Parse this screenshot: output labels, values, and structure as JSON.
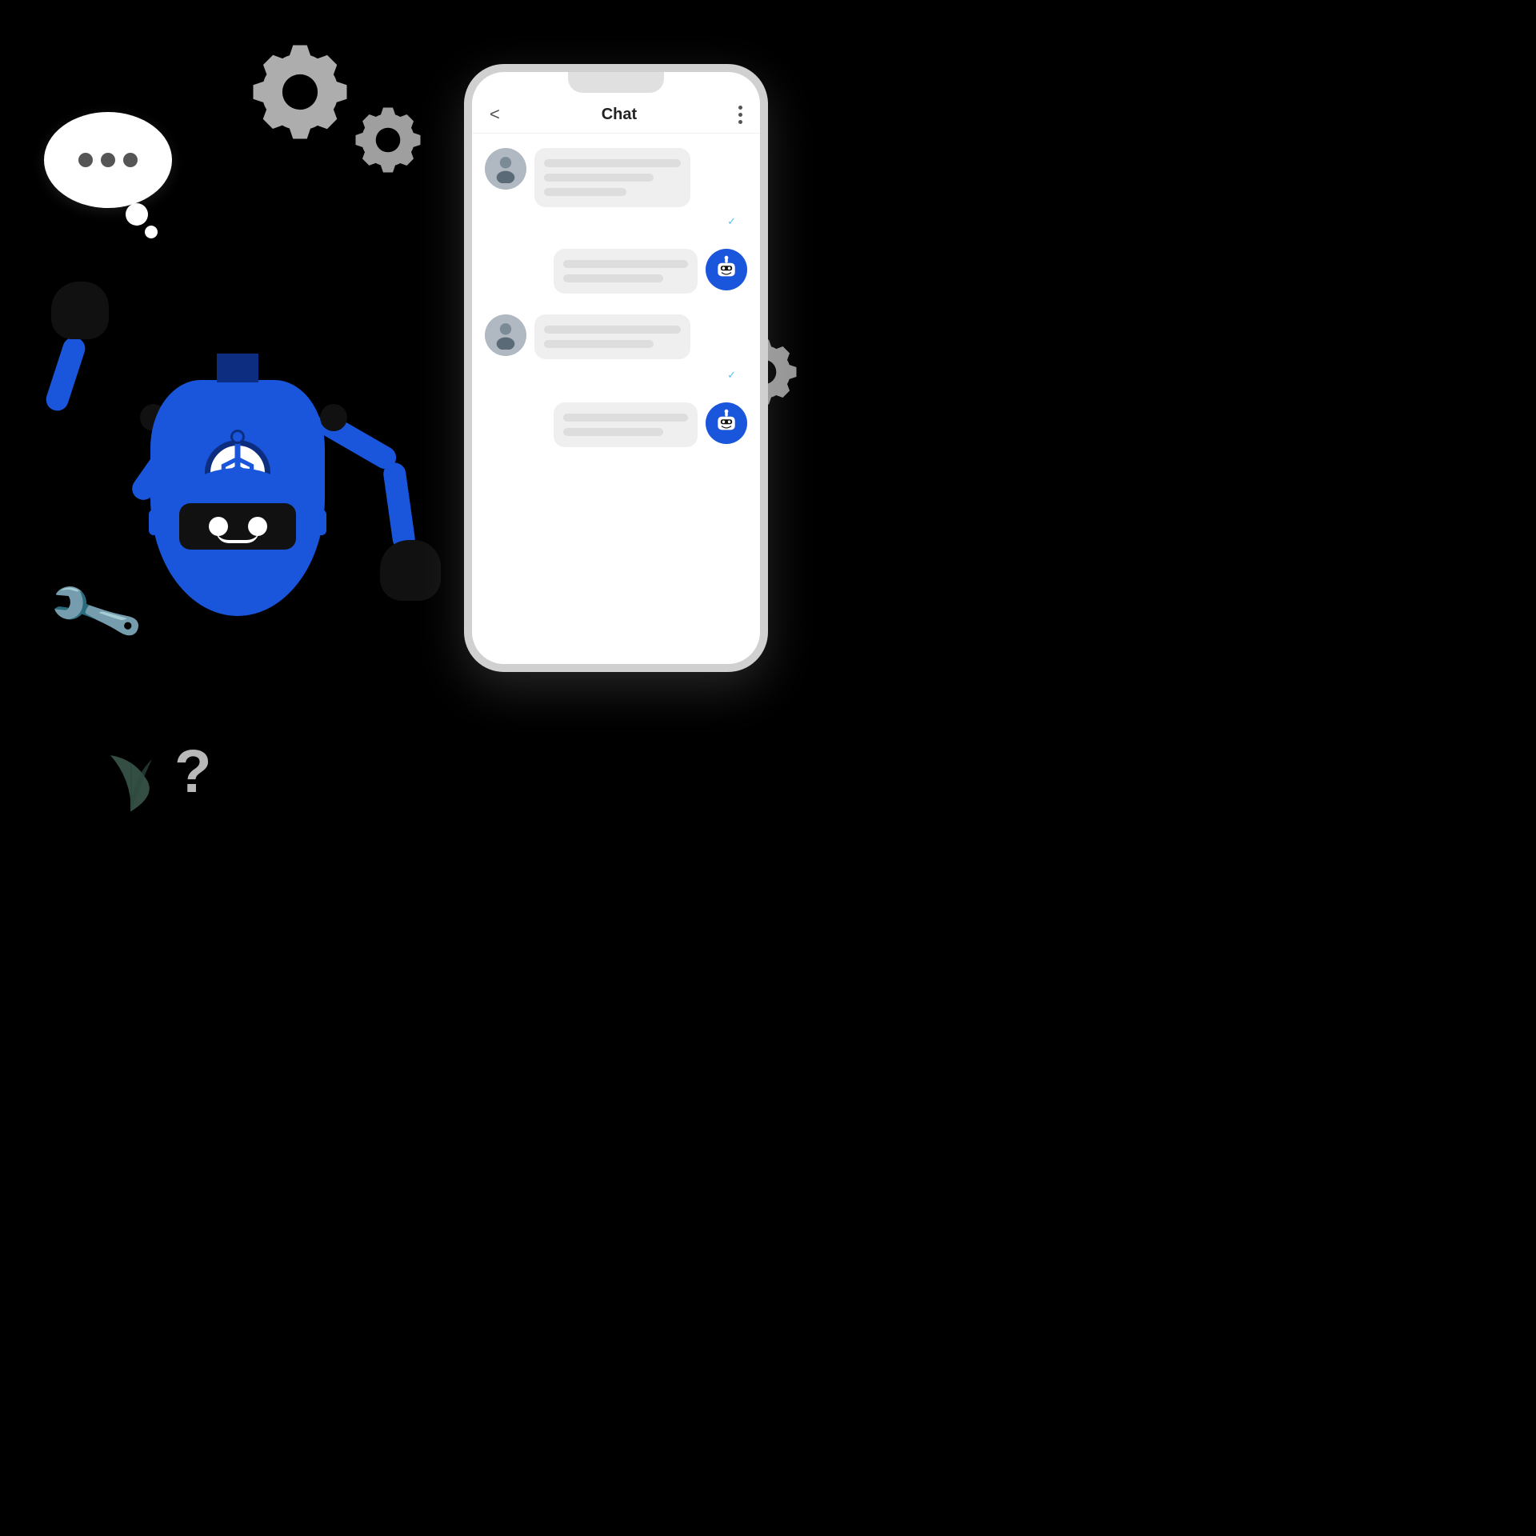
{
  "scene": {
    "background": "#000000"
  },
  "phone": {
    "title": "Chat",
    "back_label": "<",
    "menu_dots": "⋮"
  },
  "chat": {
    "messages": [
      {
        "sender": "human",
        "lines": 3
      },
      {
        "sender": "robot",
        "lines": 2
      },
      {
        "sender": "human",
        "lines": 2
      },
      {
        "sender": "robot",
        "lines": 2
      }
    ]
  },
  "robot": {
    "label": "AI Chatbot Robot"
  },
  "speech_bubble": {
    "dots": [
      "•",
      "•",
      "•"
    ]
  },
  "decorations": {
    "gear_label": "settings gear",
    "wrench_label": "wrench tool",
    "question_label": "question mark",
    "leaf_label": "plant leaf"
  }
}
